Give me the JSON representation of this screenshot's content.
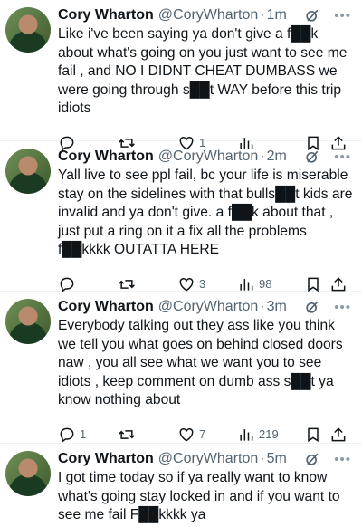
{
  "tweets": [
    {
      "name": "Cory Wharton",
      "handle": "@CoryWharton",
      "time": "1m",
      "text": "Like i've been saying ya don't give a f██k about what's going on you just want to see me fail , and NO I DIDNT CHEAT DUMBASS we were going through s██t WAY before this trip idiots",
      "replies": "",
      "retweets": "",
      "likes": "1",
      "views": ""
    },
    {
      "name": "Cory Wharton",
      "handle": "@CoryWharton",
      "time": "2m",
      "text": "Yall live to see ppl fail, bc your life is miserable stay on the sidelines with that bulls██t kids are invalid and ya don't give. a f██k about that , just put a ring on it a fix all the problems f██kkkk OUTATTA HERE",
      "replies": "",
      "retweets": "",
      "likes": "3",
      "views": "98"
    },
    {
      "name": "Cory Wharton",
      "handle": "@CoryWharton",
      "time": "3m",
      "text": "Everybody talking out they ass like you think we tell you what goes on behind closed doors naw , you all see what we want you to see idiots , keep comment on dumb ass s██t ya know nothing about",
      "replies": "1",
      "retweets": "",
      "likes": "7",
      "views": "219"
    },
    {
      "name": "Cory Wharton",
      "handle": "@CoryWharton",
      "time": "5m",
      "text": "I got time today so if ya really want to know what's going stay locked in and if you want to see me fail F██kkkk ya",
      "replies": "",
      "retweets": "",
      "likes": "",
      "views": ""
    }
  ],
  "separator": "·",
  "icons": {
    "reply": "reply-icon",
    "retweet": "retweet-icon",
    "like": "heart-icon",
    "views": "views-icon",
    "bookmark": "bookmark-icon",
    "share": "share-icon",
    "grok": "grok-icon",
    "more": "more-icon"
  }
}
